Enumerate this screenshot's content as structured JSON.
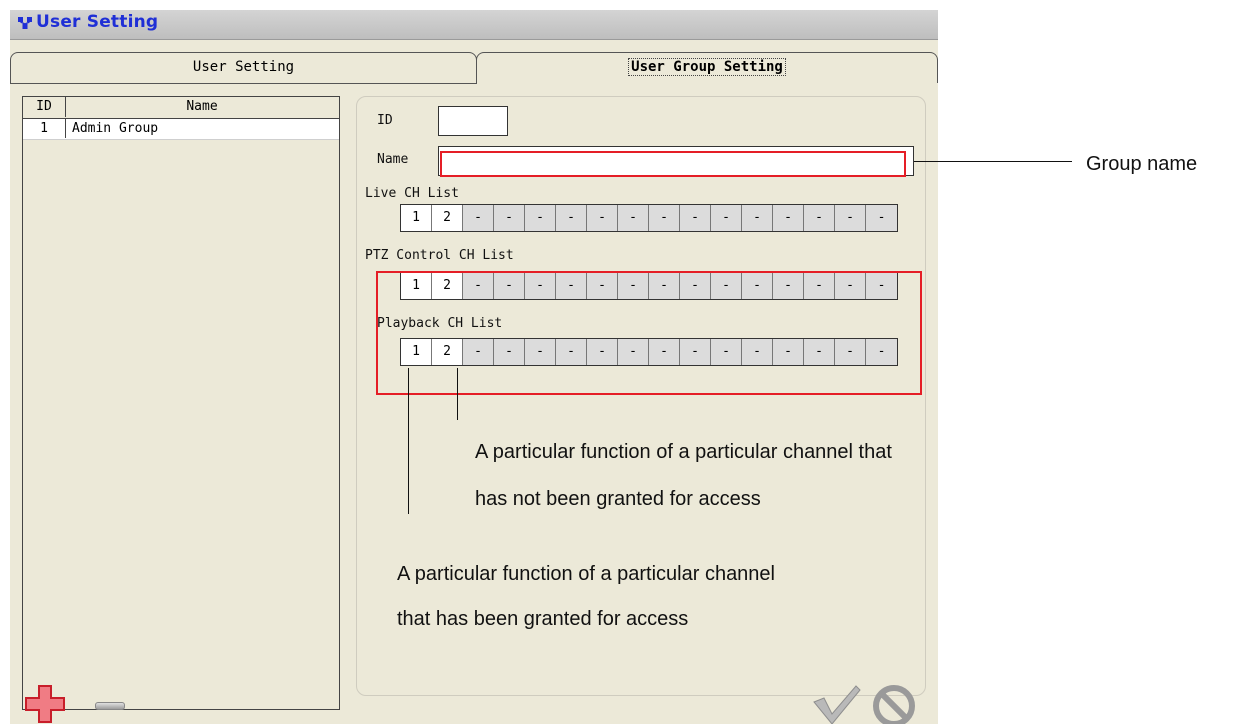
{
  "window": {
    "title": "User Setting"
  },
  "tabs": [
    {
      "label": "User Setting"
    },
    {
      "label": "User Group Setting"
    }
  ],
  "group_list": {
    "headers": {
      "id": "ID",
      "name": "Name"
    },
    "rows": [
      {
        "id": "1",
        "name": "Admin Group"
      }
    ]
  },
  "form": {
    "id_label": "ID",
    "id_value": "",
    "name_label": "Name",
    "name_value": "",
    "live_label": "Live CH List",
    "ptz_label": "PTZ Control CH List",
    "playback_label": "Playback CH List",
    "channels": [
      "1",
      "2",
      "-",
      "-",
      "-",
      "-",
      "-",
      "-",
      "-",
      "-",
      "-",
      "-",
      "-",
      "-",
      "-",
      "-"
    ],
    "granted_count": 2
  },
  "annotations": {
    "group_name": "Group name",
    "not_granted_line1": "A particular function of a particular channel that",
    "not_granted_line2": "has not been granted for access",
    "granted_line1": "A particular function of a particular channel",
    "granted_line2": "that has been granted for access"
  },
  "colors": {
    "title": "#1f2fd6",
    "highlight": "#e51e26",
    "add_button": "#e8424a"
  },
  "icons": {
    "title": "network-icon",
    "add": "plus-icon",
    "remove": "minus-icon",
    "ok": "checkmark-icon",
    "cancel": "cancel-icon"
  }
}
